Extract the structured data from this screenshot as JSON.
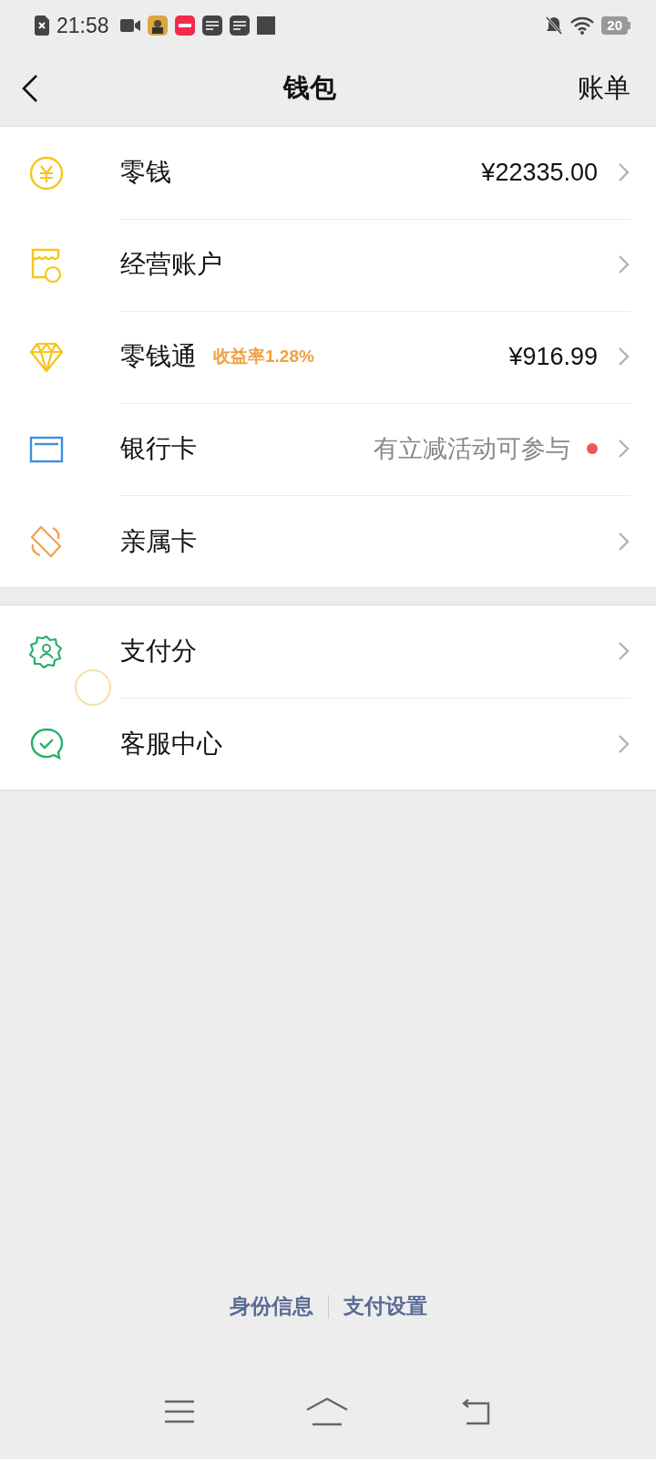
{
  "status_bar": {
    "time": "21:58",
    "battery": "20"
  },
  "header": {
    "title": "钱包",
    "action": "账单"
  },
  "groups": [
    {
      "rows": [
        {
          "kind": "coin",
          "label": "零钱",
          "value": "¥22335.00"
        },
        {
          "kind": "shop",
          "label": "经营账户"
        },
        {
          "kind": "diamond",
          "label": "零钱通",
          "tag": "收益率1.28%",
          "value": "¥916.99"
        },
        {
          "kind": "card",
          "label": "银行卡",
          "hint": "有立减活动可参与",
          "dot": true
        },
        {
          "kind": "family",
          "label": "亲属卡"
        }
      ]
    },
    {
      "rows": [
        {
          "kind": "score",
          "label": "支付分"
        },
        {
          "kind": "service",
          "label": "客服中心"
        }
      ]
    }
  ],
  "footer_links": [
    "身份信息",
    "支付设置"
  ]
}
